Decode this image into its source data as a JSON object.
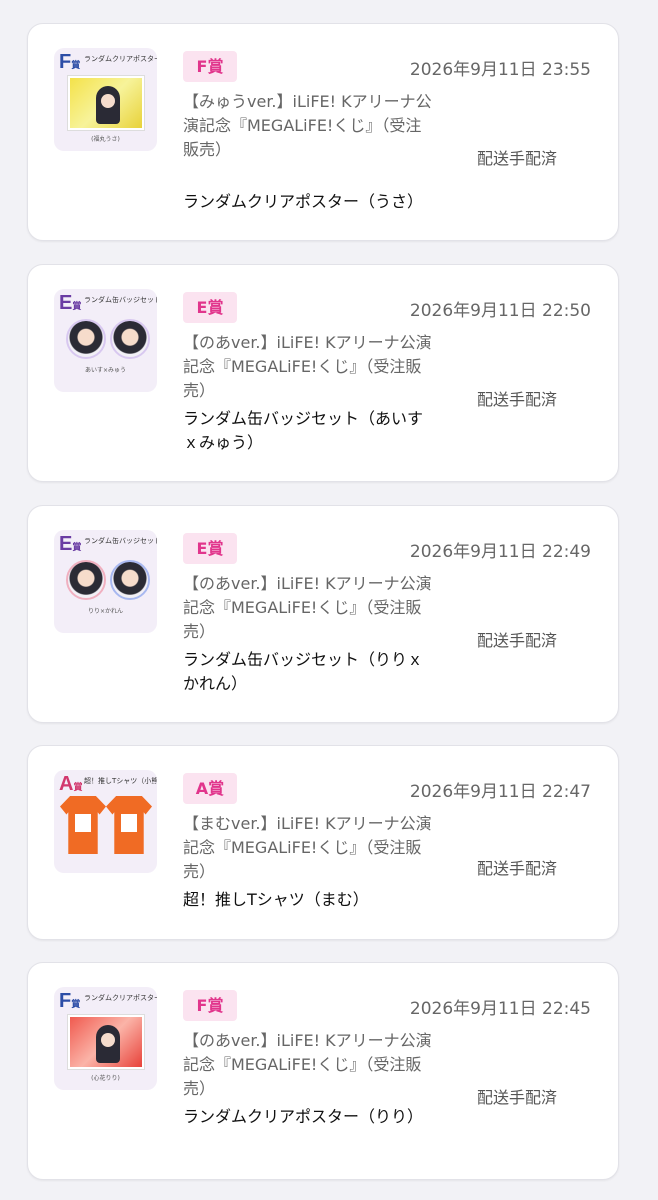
{
  "orders": [
    {
      "prize": "F賞",
      "datetime": "2026年9月11日 23:55",
      "title": "【みゅうver.】iLiFE! Kアリーナ公演記念『MEGALiFE!くじ』（受注販売）",
      "item": "ランダムクリアポスター（うさ）",
      "status": "配送手配済",
      "thumb": {
        "rank": "F",
        "rank_suffix": "賞",
        "label": "ランダムクリアポスター",
        "caption": "(福丸うさ)",
        "kind": "poster",
        "bg": "#f3eef8",
        "poster_bg": "#f4e24a",
        "rank_color": "#2c4da6"
      }
    },
    {
      "prize": "E賞",
      "datetime": "2026年9月11日 22:50",
      "title": "【のあver.】iLiFE! Kアリーナ公演記念『MEGALiFE!くじ』（受注販売）",
      "item": "ランダム缶バッジセット（あいすｘみゅう）",
      "status": "配送手配済",
      "thumb": {
        "rank": "E",
        "rank_suffix": "賞",
        "label": "ランダム缶バッジセット",
        "caption": "あいす×みゅう",
        "kind": "badge",
        "bg": "#f3eef8",
        "rank_color": "#6a3ca3"
      }
    },
    {
      "prize": "E賞",
      "datetime": "2026年9月11日 22:49",
      "title": "【のあver.】iLiFE! Kアリーナ公演記念『MEGALiFE!くじ』（受注販売）",
      "item": "ランダム缶バッジセット（りりｘかれん）",
      "status": "配送手配済",
      "thumb": {
        "rank": "E",
        "rank_suffix": "賞",
        "label": "ランダム缶バッジセット",
        "caption": "りり×かれん",
        "kind": "badge",
        "bg": "#f3eef8",
        "rank_color": "#6a3ca3"
      }
    },
    {
      "prize": "A賞",
      "datetime": "2026年9月11日 22:47",
      "title": "【まむver.】iLiFE! Kアリーナ公演記念『MEGALiFE!くじ』（受注販売）",
      "item": "超！推しTシャツ（まむ）",
      "status": "配送手配済",
      "thumb": {
        "rank": "A",
        "rank_suffix": "賞",
        "label": "超！推しTシャツ（小熊まむ）",
        "caption": "",
        "kind": "tshirt",
        "bg": "#f3eef8",
        "rank_color": "#d2386e"
      }
    },
    {
      "prize": "F賞",
      "datetime": "2026年9月11日 22:45",
      "title": "【のあver.】iLiFE! Kアリーナ公演記念『MEGALiFE!くじ』（受注販売）",
      "item": "ランダムクリアポスター（りり）",
      "status": "配送手配済",
      "thumb": {
        "rank": "F",
        "rank_suffix": "賞",
        "label": "ランダムクリアポスター",
        "caption": "(心花りり)",
        "kind": "poster",
        "bg": "#f3eef8",
        "poster_bg": "#f05a4f",
        "rank_color": "#2c4da6"
      }
    }
  ]
}
